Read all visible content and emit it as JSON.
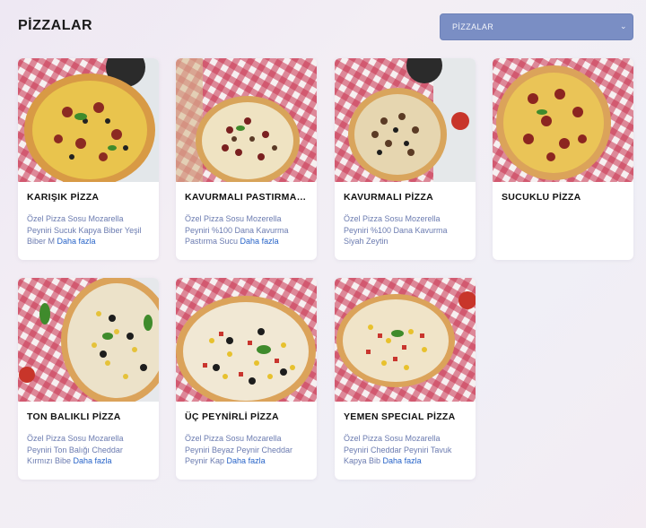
{
  "header": {
    "title": "PİZZALAR"
  },
  "category_select": {
    "selected": "PİZZALAR"
  },
  "products": [
    {
      "name": "KARIŞIK PİZZA",
      "description": "Özel Pizza Sosu Mozarella Peyniri Sucuk Kapya Biber Yeşil Biber M",
      "more_label": "Daha fazla"
    },
    {
      "name": "KAVURMALI PASTIRMAL...",
      "description": "Özel Pizza Sosu Mozerella Peyniri %100 Dana Kavurma Pastırma Sucu",
      "more_label": "Daha fazla"
    },
    {
      "name": "KAVURMALI PİZZA",
      "description": "Özel Pizza Sosu Mozerella Peyniri %100 Dana Kavurma Siyah Zeytin",
      "more_label": ""
    },
    {
      "name": "SUCUKLU PİZZA",
      "description": "",
      "more_label": ""
    },
    {
      "name": "TON BALIKLI PİZZA",
      "description": "Özel Pizza Sosu Mozarella Peyniri Ton Balığı Cheddar Kırmızı Bibe",
      "more_label": "Daha fazla"
    },
    {
      "name": "ÜÇ PEYNİRLİ PİZZA",
      "description": "Özel Pizza Sosu Mozarella Peyniri Beyaz Peynir Cheddar Peynir Kap",
      "more_label": "Daha fazla"
    },
    {
      "name": "YEMEN SPECIAL PİZZA",
      "description": "Özel Pizza Sosu Mozarella Peyniri Cheddar Peyniri Tavuk Kapya Bib",
      "more_label": "Daha fazla"
    }
  ],
  "colors": {
    "select_bg": "#7a8ec4",
    "link": "#2763c8",
    "description": "#6b7bb0",
    "tablecloth": "#c8324f"
  }
}
